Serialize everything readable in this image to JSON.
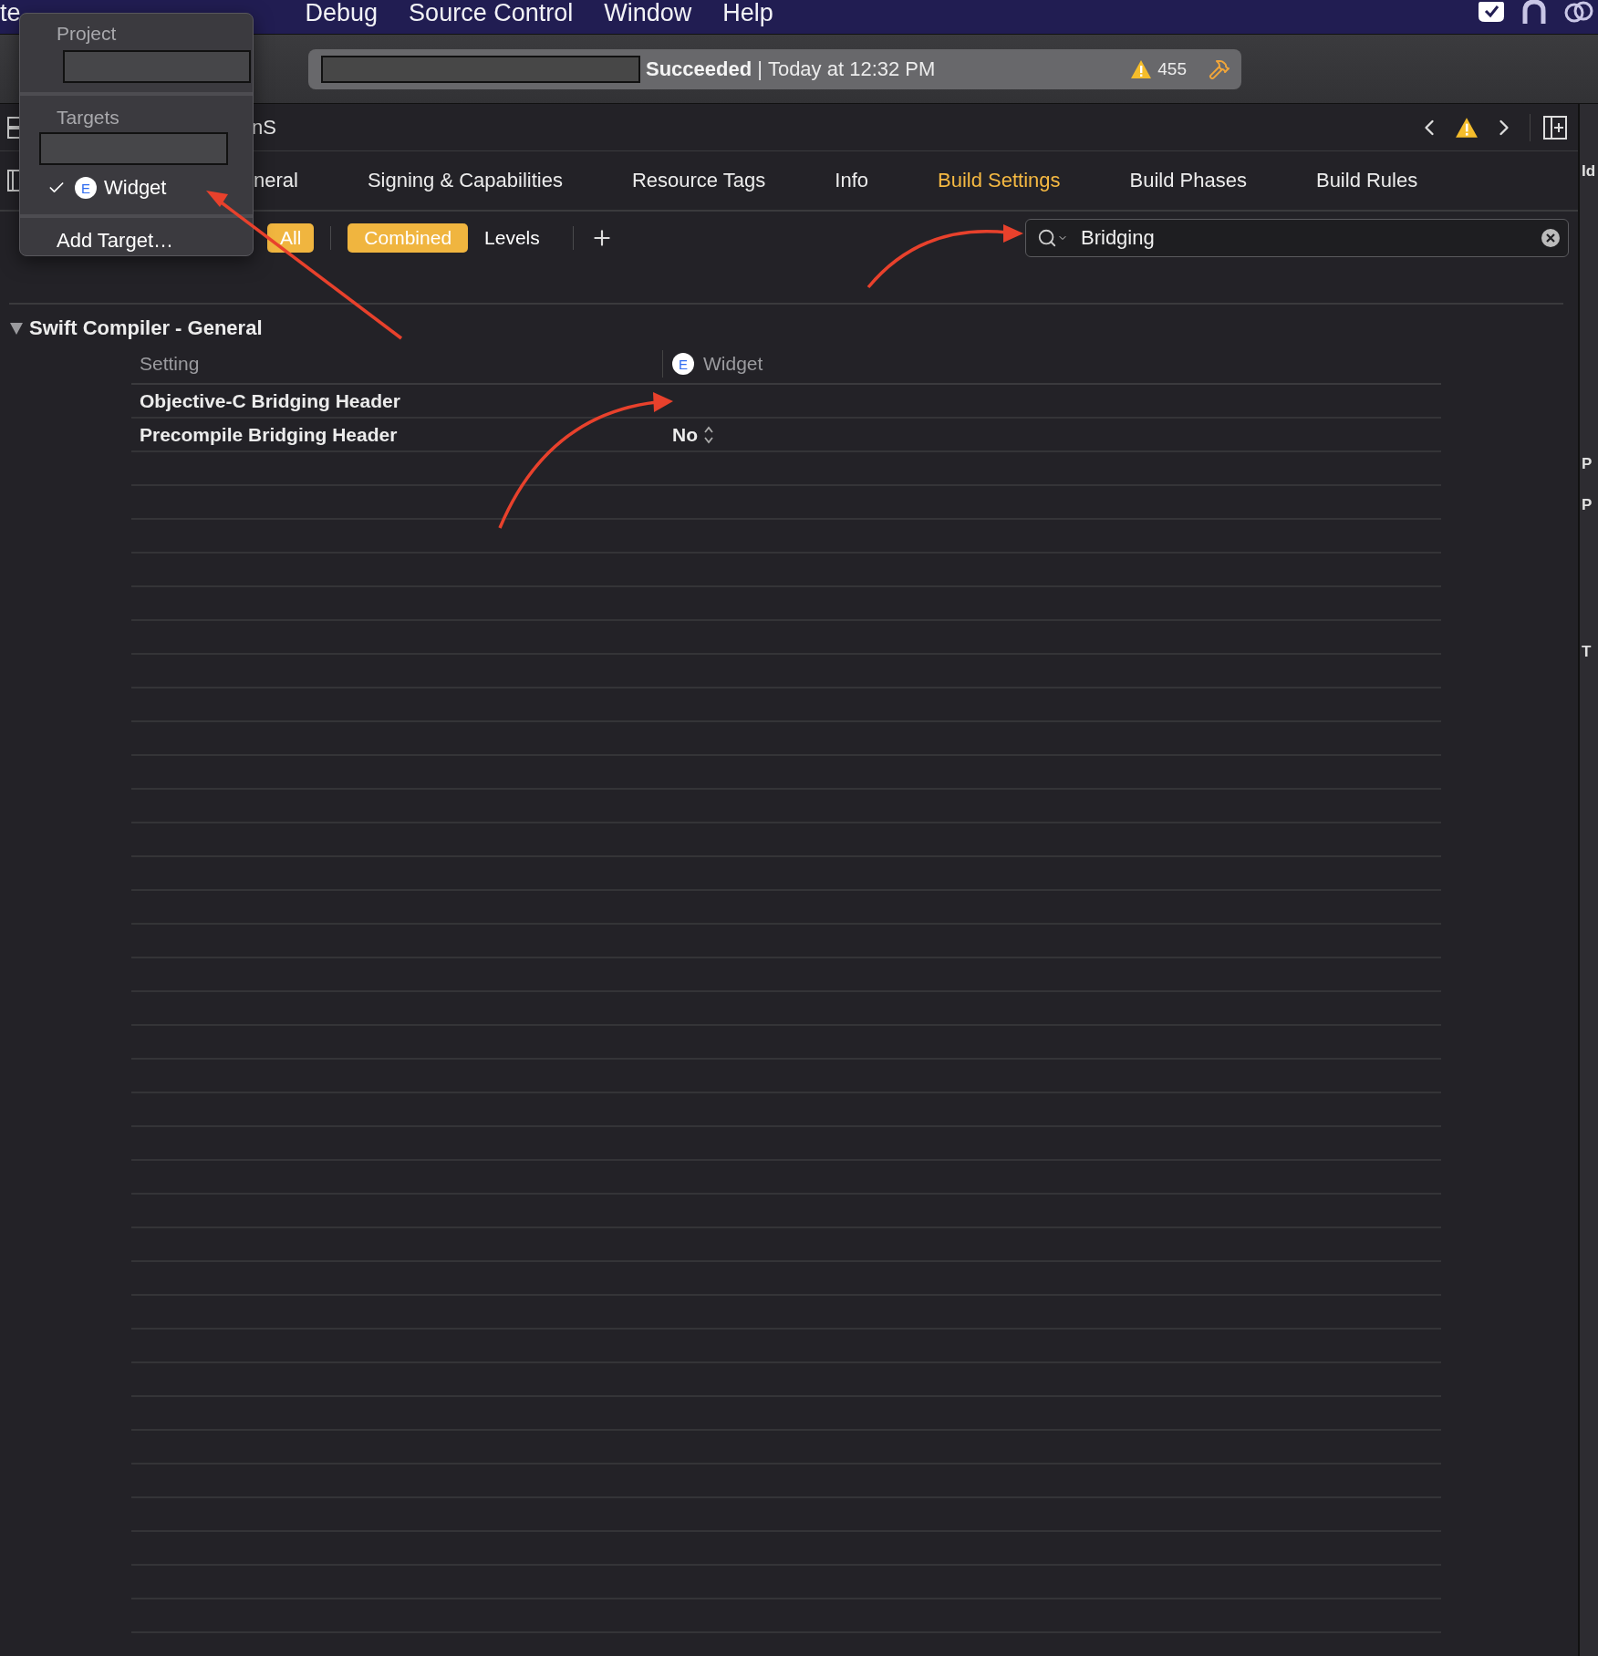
{
  "menu_bar": {
    "items": [
      "te",
      "Debug",
      "Source Control",
      "Window",
      "Help"
    ]
  },
  "activity": {
    "status": "Succeeded",
    "separator": "|",
    "time": "Today at 12:32 PM",
    "warnings": "455"
  },
  "jump_bar": {
    "path": "nS"
  },
  "tabs": [
    {
      "label": "neral",
      "selected": false
    },
    {
      "label": "Signing & Capabilities",
      "selected": false
    },
    {
      "label": "Resource Tags",
      "selected": false
    },
    {
      "label": "Info",
      "selected": false
    },
    {
      "label": "Build Settings",
      "selected": true
    },
    {
      "label": "Build Phases",
      "selected": false
    },
    {
      "label": "Build Rules",
      "selected": false
    }
  ],
  "filters": [
    {
      "label": "All",
      "selected": true,
      "kind": "scope"
    },
    {
      "label": "Combined",
      "selected": true,
      "kind": "view"
    },
    {
      "label": "Levels",
      "selected": false,
      "kind": "view"
    }
  ],
  "search": {
    "value": "Bridging"
  },
  "section": {
    "title": "Swift Compiler - General",
    "expanded": true,
    "columns": [
      {
        "label": "Setting"
      },
      {
        "label": "Widget",
        "badge": "E"
      }
    ],
    "rows": [
      {
        "setting": "Objective-C Bridging Header"
      },
      {
        "setting": "Precompile Bridging Header",
        "value": "No"
      }
    ]
  },
  "target_popup": {
    "project_title": "Project",
    "targets_title": "Targets",
    "targets": [
      {
        "label": "Widget",
        "badge": "E",
        "checked": true
      }
    ],
    "action": "Add Target…"
  },
  "inspector": {
    "labels": [
      "Id",
      "P",
      "P",
      "T"
    ]
  }
}
